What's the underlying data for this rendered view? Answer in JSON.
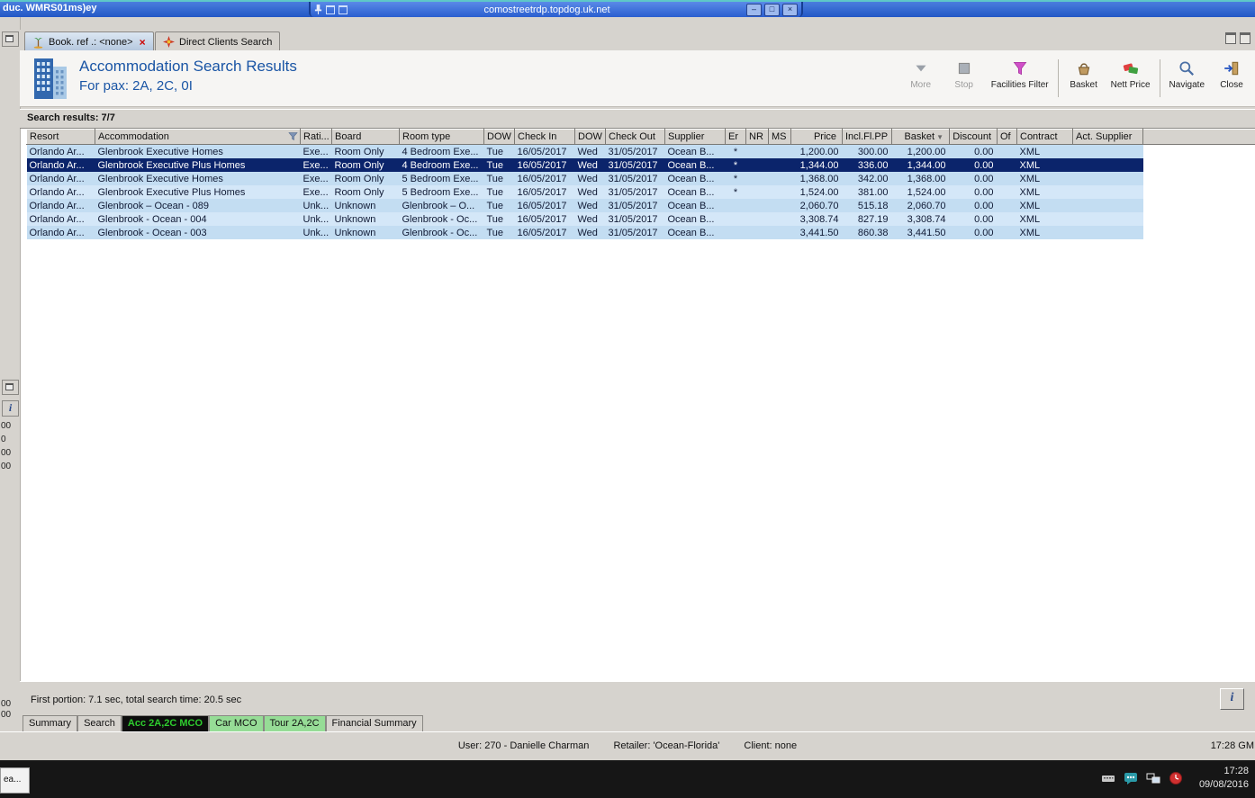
{
  "window": {
    "title_fragment": "duc. WMRS01ms)ey",
    "rdp_host": "comostreetrdp.topdog.uk.net"
  },
  "icons": {
    "tab_close": "×",
    "sort_desc": "▼",
    "info": "i",
    "rdp_minimize": "–",
    "rdp_restore": "□",
    "rdp_close": "×"
  },
  "colors": {
    "selected_row": "#0b246b",
    "row_shade_dark": "#c3ddf2",
    "row_shade_light": "#d4e7f8",
    "active_bottom_tab_text": "#2ecc2e",
    "title_blue": "#1a55a5"
  },
  "tabs": {
    "booking": "Book. ref .: <none>",
    "direct_clients": "Direct Clients Search"
  },
  "header": {
    "title": "Accommodation Search Results",
    "subtitle": "For pax: 2A, 2C, 0I"
  },
  "toolbar": {
    "more": "More",
    "stop": "Stop",
    "facilities_filter": "Facilities Filter",
    "basket": "Basket",
    "nett_price": "Nett Price",
    "navigate": "Navigate",
    "close": "Close"
  },
  "results_label": "Search results: 7/7",
  "table": {
    "columns": [
      "Resort",
      "Accommodation",
      "Rati...",
      "Board",
      "Room type",
      "DOW",
      "Check In",
      "DOW",
      "Check Out",
      "Supplier",
      "Er",
      "NR",
      "MS",
      "Price",
      "Incl.Fl.PP",
      "Basket",
      "Discount",
      "Of",
      "Contract",
      "Act. Supplier"
    ],
    "filter_icon_column": 1,
    "sort_icon_column": 15,
    "selected_index": 1,
    "rows": [
      [
        "Orlando Ar...",
        "Glenbrook Executive Homes",
        "Exe...",
        "Room Only",
        "4 Bedroom Exe...",
        "Tue",
        "16/05/2017",
        "Wed",
        "31/05/2017",
        "Ocean B...",
        "*",
        "",
        "",
        "1,200.00",
        "300.00",
        "1,200.00",
        "0.00",
        "",
        "XML",
        ""
      ],
      [
        "Orlando Ar...",
        "Glenbrook Executive Plus Homes",
        "Exe...",
        "Room Only",
        "4 Bedroom Exe...",
        "Tue",
        "16/05/2017",
        "Wed",
        "31/05/2017",
        "Ocean B...",
        "*",
        "",
        "",
        "1,344.00",
        "336.00",
        "1,344.00",
        "0.00",
        "",
        "XML",
        ""
      ],
      [
        "Orlando Ar...",
        "Glenbrook Executive Homes",
        "Exe...",
        "Room Only",
        "5 Bedroom Exe...",
        "Tue",
        "16/05/2017",
        "Wed",
        "31/05/2017",
        "Ocean B...",
        "*",
        "",
        "",
        "1,368.00",
        "342.00",
        "1,368.00",
        "0.00",
        "",
        "XML",
        ""
      ],
      [
        "Orlando Ar...",
        "Glenbrook Executive Plus Homes",
        "Exe...",
        "Room Only",
        "5 Bedroom Exe...",
        "Tue",
        "16/05/2017",
        "Wed",
        "31/05/2017",
        "Ocean B...",
        "*",
        "",
        "",
        "1,524.00",
        "381.00",
        "1,524.00",
        "0.00",
        "",
        "XML",
        ""
      ],
      [
        "Orlando Ar...",
        "Glenbrook – Ocean - 089",
        "Unk...",
        "Unknown",
        "Glenbrook – O...",
        "Tue",
        "16/05/2017",
        "Wed",
        "31/05/2017",
        "Ocean B...",
        "",
        "",
        "",
        "2,060.70",
        "515.18",
        "2,060.70",
        "0.00",
        "",
        "XML",
        ""
      ],
      [
        "Orlando Ar...",
        "Glenbrook - Ocean - 004",
        "Unk...",
        "Unknown",
        "Glenbrook - Oc...",
        "Tue",
        "16/05/2017",
        "Wed",
        "31/05/2017",
        "Ocean B...",
        "",
        "",
        "",
        "3,308.74",
        "827.19",
        "3,308.74",
        "0.00",
        "",
        "XML",
        ""
      ],
      [
        "Orlando Ar...",
        "Glenbrook - Ocean - 003",
        "Unk...",
        "Unknown",
        "Glenbrook - Oc...",
        "Tue",
        "16/05/2017",
        "Wed",
        "31/05/2017",
        "Ocean B...",
        "",
        "",
        "",
        "3,441.50",
        "860.38",
        "3,441.50",
        "0.00",
        "",
        "XML",
        ""
      ]
    ]
  },
  "footer": {
    "search_time": "First portion: 7.1 sec, total search time: 20.5 sec"
  },
  "bottom_tabs": [
    {
      "label": "Summary",
      "style": "plain"
    },
    {
      "label": "Search",
      "style": "plain"
    },
    {
      "label": "Acc 2A,2C MCO",
      "style": "active"
    },
    {
      "label": "Car MCO",
      "style": "green"
    },
    {
      "label": "Tour 2A,2C",
      "style": "green"
    },
    {
      "label": "Financial Summary",
      "style": "plain"
    }
  ],
  "status_bar": {
    "user": "User: 270 - Danielle Charman",
    "retailer": "Retailer: 'Ocean-Florida'",
    "client": "Client: none",
    "time": "17:28 GM"
  },
  "left_strip": {
    "mid_fragments": [
      "00",
      "0",
      "00",
      "00"
    ],
    "bottom_fragments": [
      "00",
      "00"
    ]
  },
  "taskbar": {
    "app_button": "ea...",
    "time": "17:28",
    "date": "09/08/2016"
  }
}
